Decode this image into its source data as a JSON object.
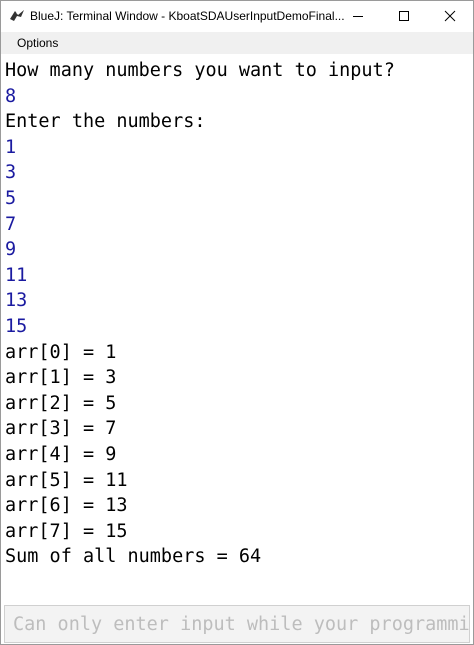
{
  "window": {
    "title": "BlueJ: Terminal Window - KboatSDAUserInputDemoFinal..."
  },
  "menu": {
    "options_label": "Options"
  },
  "terminal": {
    "lines": [
      {
        "text": "How many numbers you want to input?",
        "kind": "output"
      },
      {
        "text": "8",
        "kind": "input"
      },
      {
        "text": "Enter the numbers:",
        "kind": "output"
      },
      {
        "text": "1",
        "kind": "input"
      },
      {
        "text": "3",
        "kind": "input"
      },
      {
        "text": "5",
        "kind": "input"
      },
      {
        "text": "7",
        "kind": "input"
      },
      {
        "text": "9",
        "kind": "input"
      },
      {
        "text": "11",
        "kind": "input"
      },
      {
        "text": "13",
        "kind": "input"
      },
      {
        "text": "15",
        "kind": "input"
      },
      {
        "text": "arr[0] = 1",
        "kind": "output"
      },
      {
        "text": "arr[1] = 3",
        "kind": "output"
      },
      {
        "text": "arr[2] = 5",
        "kind": "output"
      },
      {
        "text": "arr[3] = 7",
        "kind": "output"
      },
      {
        "text": "arr[4] = 9",
        "kind": "output"
      },
      {
        "text": "arr[5] = 11",
        "kind": "output"
      },
      {
        "text": "arr[6] = 13",
        "kind": "output"
      },
      {
        "text": "arr[7] = 15",
        "kind": "output"
      },
      {
        "text": "Sum of all numbers = 64",
        "kind": "output"
      }
    ]
  },
  "input": {
    "placeholder": "Can only enter input while your programmi"
  },
  "colors": {
    "output_text": "#000000",
    "input_text": "#1a1aa0",
    "menubar_bg": "#f0f0f0"
  },
  "icons": {
    "app": "bluej-bird-icon",
    "minimize": "minimize-icon",
    "maximize": "maximize-icon",
    "close": "close-icon"
  }
}
